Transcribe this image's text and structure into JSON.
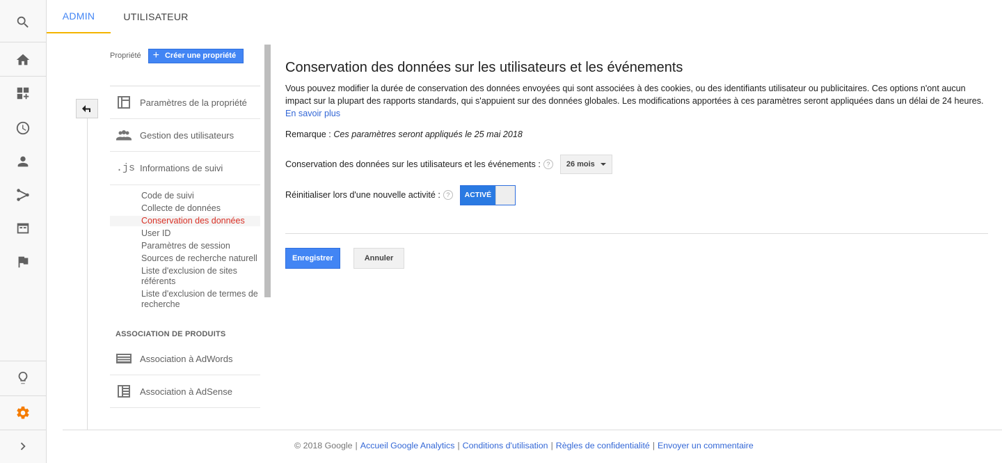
{
  "tabs": [
    {
      "label": "ADMIN",
      "active": true
    },
    {
      "label": "UTILISATEUR",
      "active": false
    }
  ],
  "rail": {
    "icons": [
      "search-icon",
      "home-icon",
      "dashboard-icon",
      "clock-icon",
      "person-icon",
      "share-icon",
      "behavior-icon",
      "flag-icon",
      "lightbulb-icon",
      "gear-icon",
      "chevron-right-icon"
    ],
    "active_icon": "gear-icon",
    "active_color": "#f57c00"
  },
  "property": {
    "label": "Propriété",
    "create_label": "Créer une propriété",
    "nav": [
      {
        "label": "Paramètres de la propriété",
        "icon": "layout-icon"
      },
      {
        "label": "Gestion des utilisateurs",
        "icon": "users-icon"
      },
      {
        "label": "Informations de suivi",
        "icon": "js-icon",
        "icon_text": ".js"
      }
    ],
    "sub_items": [
      "Code de suivi",
      "Collecte de données",
      "Conservation des données",
      "User ID",
      "Paramètres de session",
      "Sources de recherche naturell",
      "Liste d'exclusion de sites référents",
      "Liste d'exclusion de termes de recherche"
    ],
    "active_sub": "Conservation des données",
    "section_head": "ASSOCIATION DE PRODUITS",
    "products": [
      {
        "label": "Association à AdWords",
        "icon": "adwords-icon"
      },
      {
        "label": "Association à AdSense",
        "icon": "adsense-icon"
      }
    ]
  },
  "main": {
    "title": "Conservation des données sur les utilisateurs et les événements",
    "description": "Vous pouvez modifier la durée de conservation des données envoyées qui sont associées à des cookies, ou des identifiants utilisateur ou publicitaires. Ces options n'ont aucun impact sur la plupart des rapports standards, qui s'appuient sur des données globales. Les modifications apportées à ces paramètres seront appliquées dans un délai de 24 heures.",
    "learn_more": "En savoir plus",
    "note_label": "Remarque :",
    "note_text": "Ces paramètres seront appliqués le 25 mai 2018",
    "retention_label": "Conservation des données sur les utilisateurs et les événements :",
    "retention_value": "26 mois",
    "reset_label": "Réinitialiser lors d'une nouvelle activité :",
    "toggle_label": "ACTIVÉ",
    "toggle_on": true,
    "help_glyph": "?",
    "save_label": "Enregistrer",
    "cancel_label": "Annuler"
  },
  "footer": {
    "copyright": "© 2018 Google",
    "links": [
      "Accueil Google Analytics",
      "Conditions d'utilisation",
      "Règles de confidentialité",
      "Envoyer un commentaire"
    ]
  }
}
